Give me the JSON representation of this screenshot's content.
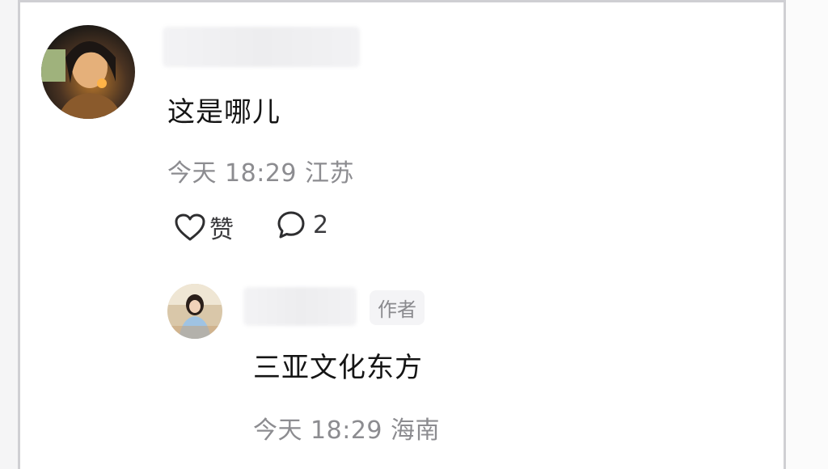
{
  "comment": {
    "text": "这是哪儿",
    "time": "今天 18:29",
    "location": "江苏",
    "like_label": "赞",
    "reply_count": "2"
  },
  "reply": {
    "author_badge": "作者",
    "text": "三亚文化东方",
    "time": "今天 18:29",
    "location": "海南"
  },
  "icons": {
    "like": "heart-icon",
    "comment": "comment-bubble-icon"
  },
  "colors": {
    "background": "#ffffff",
    "meta_text": "#8c8c90",
    "main_text": "#151515"
  }
}
